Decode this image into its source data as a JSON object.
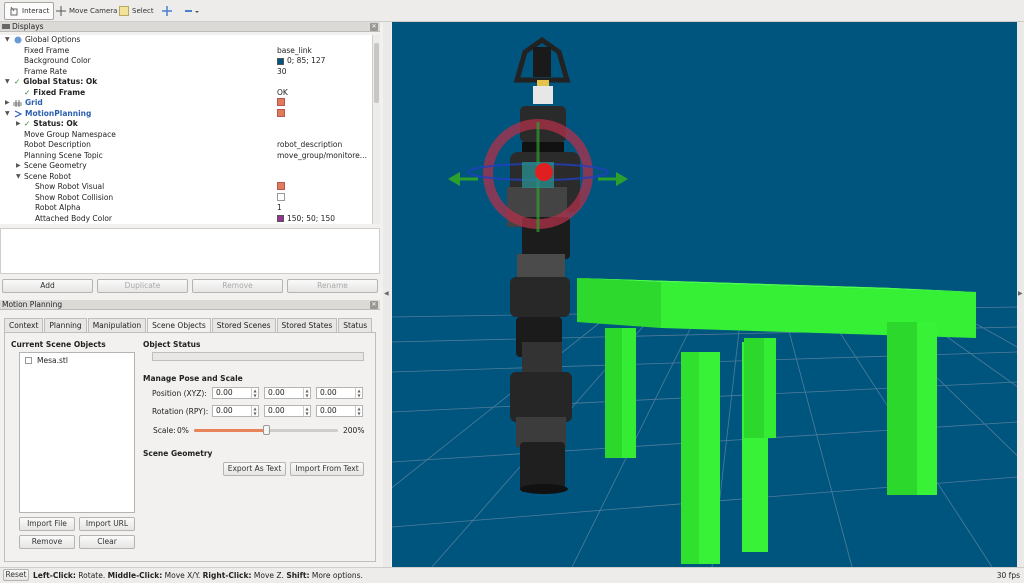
{
  "toolbar": {
    "interact": "Interact",
    "move_camera": "Move Camera",
    "select": "Select",
    "colors": {
      "select_icon": "#f3e39a",
      "crosshair": "#4a7fd0"
    }
  },
  "displays": {
    "title": "Displays",
    "rows": [
      {
        "label": "Global Options",
        "value": ""
      },
      {
        "label": "Fixed Frame",
        "value": "base_link"
      },
      {
        "label": "Background Color",
        "value": "0; 85; 127"
      },
      {
        "label": "Frame Rate",
        "value": "30"
      },
      {
        "label": "Global Status: Ok",
        "value": ""
      },
      {
        "label": "Fixed Frame",
        "value": "OK"
      },
      {
        "label": "Grid",
        "value": ""
      },
      {
        "label": "MotionPlanning",
        "value": ""
      },
      {
        "label": "Status: Ok",
        "value": ""
      },
      {
        "label": "Move Group Namespace",
        "value": ""
      },
      {
        "label": "Robot Description",
        "value": "robot_description"
      },
      {
        "label": "Planning Scene Topic",
        "value": "move_group/monitore..."
      },
      {
        "label": "Scene Geometry",
        "value": ""
      },
      {
        "label": "Scene Robot",
        "value": ""
      },
      {
        "label": "Show Robot Visual",
        "value": ""
      },
      {
        "label": "Show Robot Collision",
        "value": ""
      },
      {
        "label": "Robot Alpha",
        "value": "1"
      },
      {
        "label": "Attached Body Color",
        "value": "150; 50; 150"
      }
    ],
    "colors": {
      "background": "#00557f",
      "attached": "#963296",
      "checked": "#e07b5a"
    }
  },
  "display_buttons": {
    "add": "Add",
    "duplicate": "Duplicate",
    "remove": "Remove",
    "rename": "Rename"
  },
  "motion_planning": {
    "title": "Motion Planning",
    "tabs": [
      "Context",
      "Planning",
      "Manipulation",
      "Scene Objects",
      "Stored Scenes",
      "Stored States",
      "Status"
    ],
    "current_scene_objects": "Current Scene Objects",
    "objects": [
      "Mesa.stl"
    ],
    "object_status": "Object Status",
    "manage_pose": "Manage Pose and Scale",
    "position_label": "Position (XYZ):",
    "rotation_label": "Rotation (RPY):",
    "position": [
      "0.00",
      "0.00",
      "0.00"
    ],
    "rotation": [
      "0.00",
      "0.00",
      "0.00"
    ],
    "scale_label": "Scale:",
    "scale_min": "0%",
    "scale_max": "200%",
    "scale_fraction": 0.5,
    "scene_geometry": "Scene Geometry",
    "export_text": "Export As Text",
    "import_text": "Import From Text",
    "import_file": "Import File",
    "import_url": "Import URL",
    "remove": "Remove",
    "clear": "Clear"
  },
  "status_bar": {
    "reset": "Reset",
    "left": "Left-Click:",
    "left_desc": "Rotate.",
    "middle": "Middle-Click:",
    "middle_desc": "Move X/Y.",
    "right": "Right-Click:",
    "right_desc": "Move Z.",
    "shift": "Shift:",
    "shift_desc": "More options.",
    "fps": "30 fps"
  },
  "viewport": {
    "background": "#00557f",
    "table_color": "#35f035",
    "grid_color": "#4f7c9a"
  }
}
